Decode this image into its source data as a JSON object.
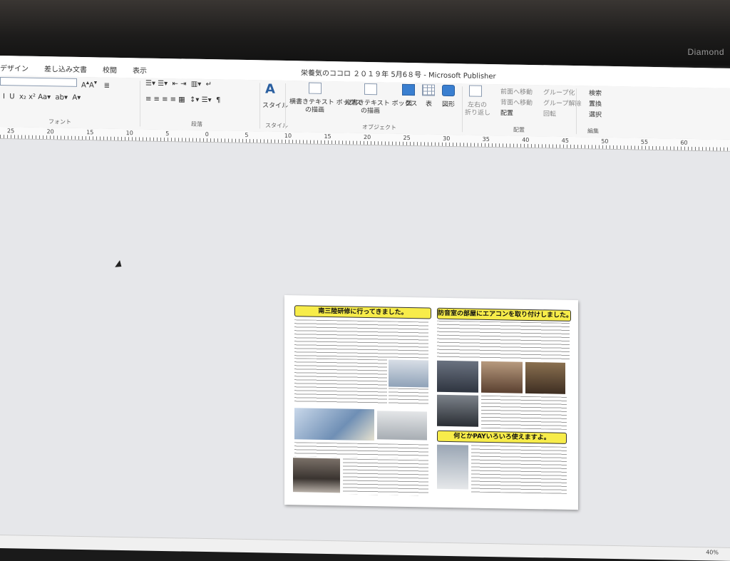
{
  "monitor": {
    "brand": "Diamond"
  },
  "menu": {
    "tabs": [
      "デザイン",
      "差し込み文書",
      "校閲",
      "表示"
    ]
  },
  "window": {
    "title": "栄養気のココロ ２０１９年 5月6８号 - Microsoft Publisher"
  },
  "ribbon": {
    "groups": {
      "font": "フォント",
      "paragraph": "段落",
      "style": "スタイル",
      "objects": "オブジェクト",
      "arrange": "配置",
      "edit": "編集"
    },
    "buttons": {
      "style": "スタイル",
      "horizontal_textbox_1": "横書きテキスト ボックス",
      "horizontal_textbox_2": "の描画",
      "vertical_textbox_1": "縦書きテキスト ボックス",
      "vertical_textbox_2": "の描画",
      "picture": "図",
      "table": "表",
      "shape": "図形",
      "wrap_1": "左右の",
      "wrap_2": "折り返し",
      "bring_forward": "前面へ移動",
      "send_backward": "背面へ移動",
      "arrange": "配置",
      "group": "グループ化",
      "ungroup": "グループ解除",
      "rotate": "回転",
      "find": "検索",
      "replace": "置換",
      "select": "選択"
    }
  },
  "ruler": {
    "numbers": [
      "25",
      "20",
      "15",
      "10",
      "5",
      "0",
      "5",
      "10",
      "15",
      "20",
      "25",
      "30",
      "35",
      "40",
      "45",
      "50",
      "55",
      "60"
    ]
  },
  "publication": {
    "headlines": {
      "left": "南三陸研修に行ってきました。",
      "right_top": "防音室の部屋にエアコンを取り付けしました。",
      "right_bottom": "何とかPAYいろいろ使えますよ。"
    }
  },
  "status": {
    "zoom": "40%"
  },
  "colors": {
    "headline_bg": "#f7ec4a",
    "workspace": "#e6e7ea"
  }
}
